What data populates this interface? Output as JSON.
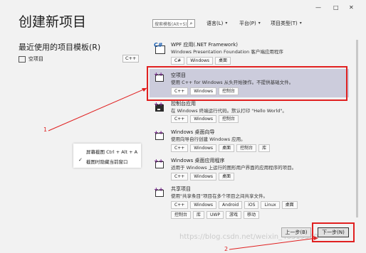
{
  "window": {
    "minimize": "—",
    "maximize": "□",
    "close": "✕"
  },
  "header": {
    "title": "创建新项目"
  },
  "recent": {
    "heading": "最近使用的项目模板(R)",
    "items": [
      {
        "label": "空项目",
        "tag": "C++"
      }
    ]
  },
  "search": {
    "placeholder": "搜索模板(Alt+S)(S)",
    "icon": "search-icon"
  },
  "filters": [
    {
      "label": "语言(L)"
    },
    {
      "label": "平台(P)"
    },
    {
      "label": "项目类型(T)"
    }
  ],
  "templates": [
    {
      "name": "WPF 应用(.NET Framework)",
      "desc": "Windows Presentation Foundation 客户端应用程序",
      "tags": [
        "C#",
        "Windows",
        "桌面"
      ]
    },
    {
      "name": "空项目",
      "desc": "使用 C++ for Windows 从头开始操作。不提供基础文件。",
      "tags": [
        "C++",
        "Windows",
        "控制台"
      ]
    },
    {
      "name": "控制台应用",
      "desc": "在 Windows 终端运行代码。默认打印 \"Hello World\"。",
      "tags": [
        "C++",
        "Windows",
        "控制台"
      ]
    },
    {
      "name": "Windows 桌面向导",
      "desc": "使用向导自行创建 Windows 应用。",
      "tags": [
        "C++",
        "Windows",
        "桌面",
        "控制台",
        "库"
      ]
    },
    {
      "name": "Windows 桌面应用程序",
      "desc": "适用于 Windows 上运行的图形用户界面的应用程序的项目。",
      "tags": [
        "C++",
        "Windows",
        "桌面"
      ]
    },
    {
      "name": "共享项目",
      "desc": "使用\"共享条目\"项目在多个项目之间共享文件。",
      "tags": [
        "C++",
        "Windows",
        "Android",
        "iOS",
        "Linux",
        "桌面",
        "控制台",
        "库",
        "UWP",
        "游戏",
        "移动"
      ]
    }
  ],
  "context_menu": {
    "items": [
      "屏幕截图 Ctrl + Alt + A",
      "截图时隐藏当前窗口"
    ],
    "checked": "✓"
  },
  "annotations": {
    "marker1": "1",
    "marker2": "2"
  },
  "footer": {
    "back": "上一步(B)",
    "next": "下一步(N)"
  },
  "watermark": "https://blog.csdn.net/weixin_46319369"
}
